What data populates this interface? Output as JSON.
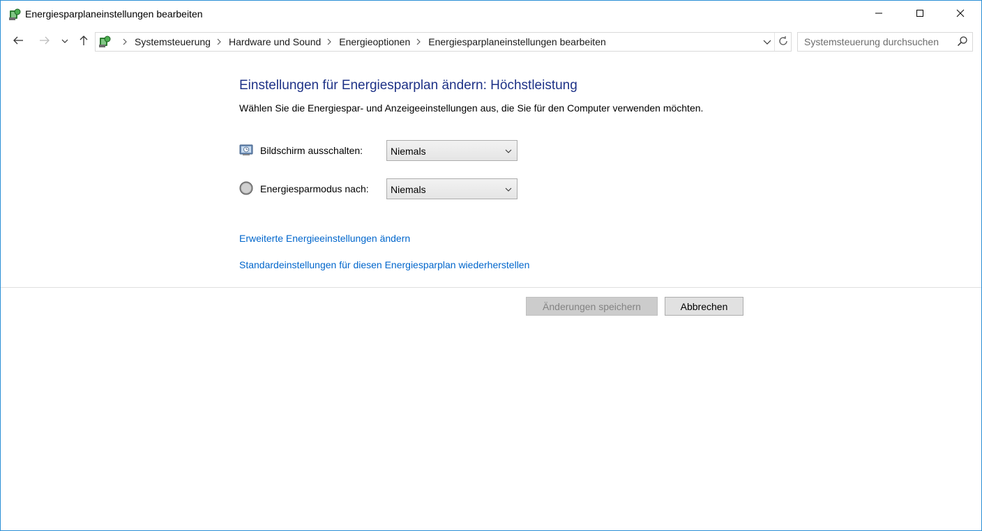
{
  "window": {
    "title": "Energiesparplaneinstellungen bearbeiten",
    "app_icon": "control-panel-icon",
    "controls": [
      "minimize-icon",
      "maximize-icon",
      "close-icon"
    ]
  },
  "nav": {
    "breadcrumbs": [
      "Systemsteuerung",
      "Hardware und Sound",
      "Energieoptionen",
      "Energiesparplaneinstellungen bearbeiten"
    ],
    "search_placeholder": "Systemsteuerung durchsuchen"
  },
  "main": {
    "heading": "Einstellungen für Energiesparplan ändern: Höchstleistung",
    "subtitle": "Wählen Sie die Energiespar- und Anzeigeeinstellungen aus, die Sie für den Computer verwenden möchten.",
    "settings": [
      {
        "label": "Bildschirm ausschalten:",
        "value": "Niemals",
        "icon": "monitor-icon"
      },
      {
        "label": "Energiesparmodus nach:",
        "value": "Niemals",
        "icon": "sleep-moon-icon"
      }
    ],
    "links": {
      "advanced": "Erweiterte Energieeinstellungen ändern",
      "restore": "Standardeinstellungen für diesen Energiesparplan wiederherstellen"
    }
  },
  "footer": {
    "save_label": "Änderungen speichern",
    "cancel_label": "Abbrechen"
  },
  "colors": {
    "heading": "#1e3287",
    "link": "#0066cc",
    "window_border": "#2b8fd6"
  }
}
